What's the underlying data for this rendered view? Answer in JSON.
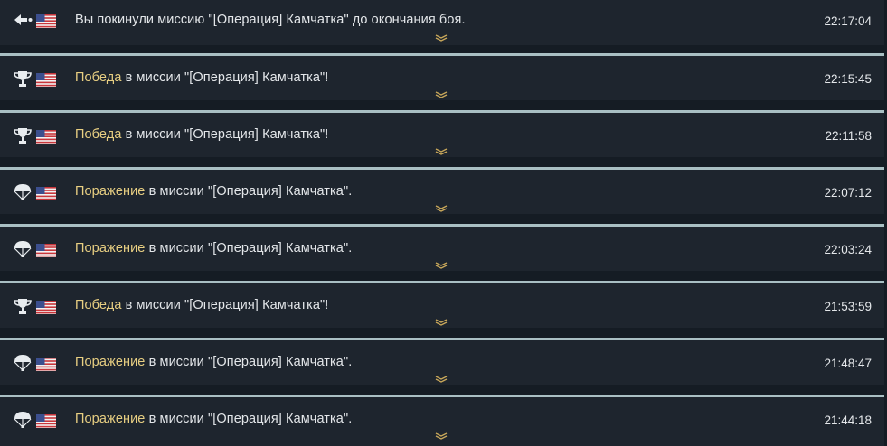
{
  "entries": [
    {
      "icon": "left-arrow-icon",
      "prefix": "",
      "result": "",
      "text": "Вы покинули миссию \"[Операция] Камчатка\" до окончания боя.",
      "time": "22:17:04"
    },
    {
      "icon": "trophy-icon",
      "prefix": "",
      "result": "Победа",
      "text": " в миссии \"[Операция] Камчатка\"!",
      "time": "22:15:45"
    },
    {
      "icon": "trophy-icon",
      "prefix": "",
      "result": "Победа",
      "text": " в миссии \"[Операция] Камчатка\"!",
      "time": "22:11:58"
    },
    {
      "icon": "parachute-icon",
      "prefix": "",
      "result": "Поражение",
      "text": " в миссии \"[Операция] Камчатка\".",
      "time": "22:07:12"
    },
    {
      "icon": "parachute-icon",
      "prefix": "",
      "result": "Поражение",
      "text": " в миссии \"[Операция] Камчатка\".",
      "time": "22:03:24"
    },
    {
      "icon": "trophy-icon",
      "prefix": "",
      "result": "Победа",
      "text": " в миссии \"[Операция] Камчатка\"!",
      "time": "21:53:59"
    },
    {
      "icon": "parachute-icon",
      "prefix": "",
      "result": "Поражение",
      "text": " в миссии \"[Операция] Камчатка\".",
      "time": "21:48:47"
    },
    {
      "icon": "parachute-icon",
      "prefix": "",
      "result": "Поражение",
      "text": " в миссии \"[Операция] Камчатка\".",
      "time": "21:44:18"
    }
  ],
  "colors": {
    "background": "#151c24",
    "row": "#1e252e",
    "separator": "#a9bfc3",
    "text": "#e4e7ea",
    "result": "#e8cf82",
    "chevron": "#c9a85a"
  },
  "flag": "us-flag-icon"
}
